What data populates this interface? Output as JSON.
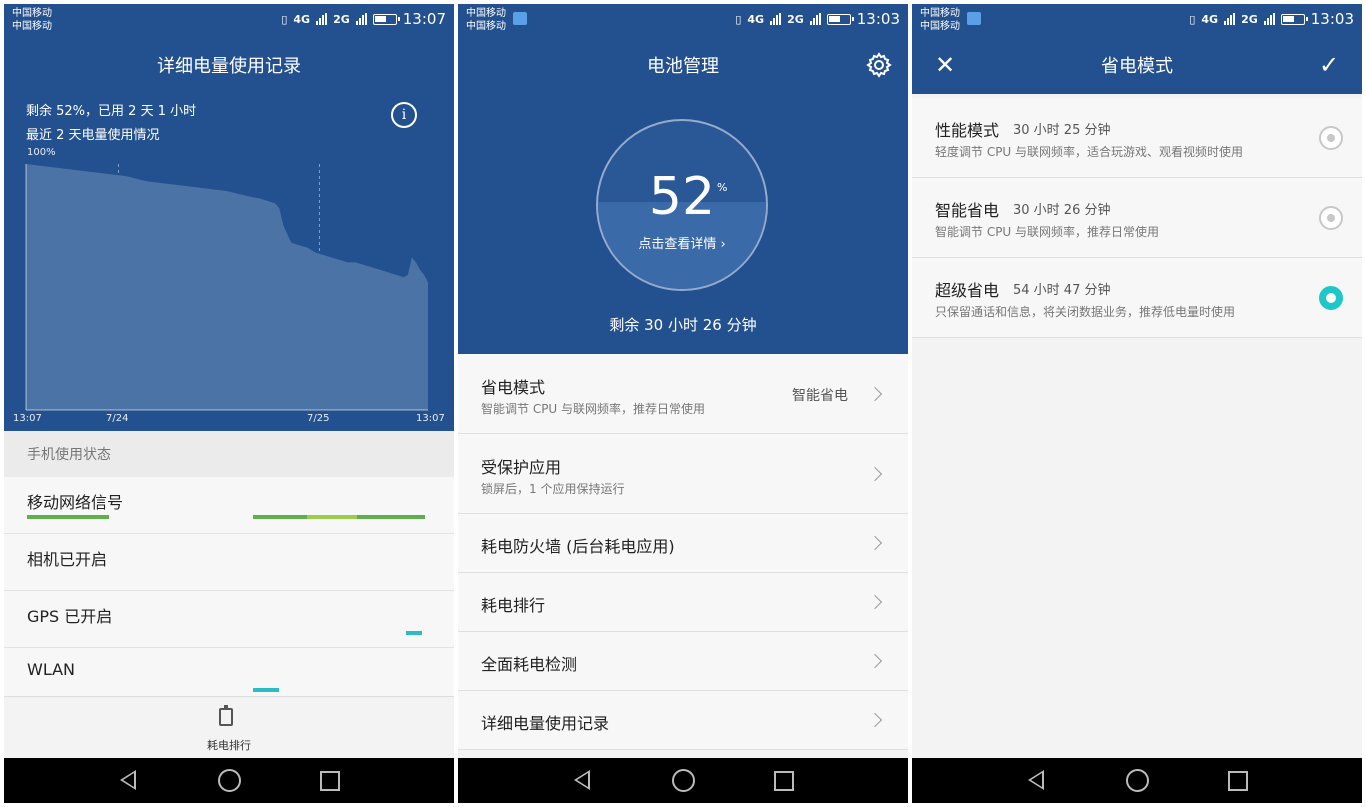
{
  "status_bar": {
    "carrier_line1": "中国移动",
    "carrier_line2": "中国移动",
    "vibrate": "▯",
    "net1": "4G",
    "net2": "2G"
  },
  "panel1": {
    "time": "13:07",
    "title": "详细电量使用记录",
    "summary_line1": "剩余 52%，已用 2 天 1 小时",
    "summary_line2": "最近 2 天电量使用情况",
    "info_icon": "i",
    "chart_data": {
      "type": "area",
      "title": "",
      "y_top_label": "100%",
      "x_labels": [
        "13:07",
        "7/24",
        "7/25",
        "13:07"
      ],
      "x": [
        0,
        5,
        10,
        15,
        20,
        25,
        30,
        35,
        40,
        45,
        50,
        55,
        58,
        60,
        62,
        63,
        64,
        66,
        68,
        70,
        72,
        74,
        76,
        78,
        80,
        82,
        84,
        86,
        88,
        90,
        92,
        94,
        95,
        96,
        97,
        98,
        99,
        100
      ],
      "y": [
        100,
        99,
        98,
        97,
        96,
        95,
        93,
        92,
        91,
        90,
        89,
        87,
        86,
        85,
        84,
        82,
        75,
        68,
        67,
        66,
        64,
        63,
        62,
        61,
        60,
        60,
        59,
        58,
        57,
        56,
        55,
        54,
        55,
        62,
        60,
        57,
        55,
        52
      ],
      "ylim": [
        0,
        100
      ],
      "grid": "vertical dashed at day boundaries",
      "fill_color": "#4b73a6"
    },
    "usage_header": "手机使用状态",
    "usage_rows": [
      {
        "label": "移动网络信号"
      },
      {
        "label": "相机已开启"
      },
      {
        "label": "GPS 已开启"
      },
      {
        "label": "WLAN"
      }
    ],
    "tab_label": "耗电排行",
    "colors": {
      "signal": "#5fb04c",
      "signal_weak": "#9ccc4c",
      "teal": "#2bbcc5"
    }
  },
  "panel2": {
    "time": "13:03",
    "title": "电池管理",
    "percent": "52",
    "percent_sign": "%",
    "percent_value": 52,
    "detail_link": "点击查看详情 ›",
    "remaining": "剩余 30 小时 26 分钟",
    "items": [
      {
        "title": "省电模式",
        "sub": "智能调节 CPU 与联网频率，推荐日常使用",
        "value": "智能省电"
      },
      {
        "title": "受保护应用",
        "sub": "锁屏后，1 个应用保持运行",
        "value": ""
      },
      {
        "title": "耗电防火墙 (后台耗电应用)",
        "sub": "",
        "value": ""
      },
      {
        "title": "耗电排行",
        "sub": "",
        "value": ""
      },
      {
        "title": "全面耗电检测",
        "sub": "",
        "value": ""
      },
      {
        "title": "详细电量使用记录",
        "sub": "",
        "value": ""
      }
    ]
  },
  "panel3": {
    "time": "13:03",
    "title": "省电模式",
    "close": "✕",
    "confirm": "✓",
    "modes": [
      {
        "name": "性能模式",
        "duration": "30 小时 25 分钟",
        "desc": "轻度调节 CPU 与联网频率，适合玩游戏、观看视频时使用",
        "selected": false
      },
      {
        "name": "智能省电",
        "duration": "30 小时 26 分钟",
        "desc": "智能调节 CPU 与联网频率，推荐日常使用",
        "selected": false
      },
      {
        "name": "超级省电",
        "duration": "54 小时 47 分钟",
        "desc": "只保留通话和信息，将关闭数据业务，推荐低电量时使用",
        "selected": true
      }
    ]
  }
}
